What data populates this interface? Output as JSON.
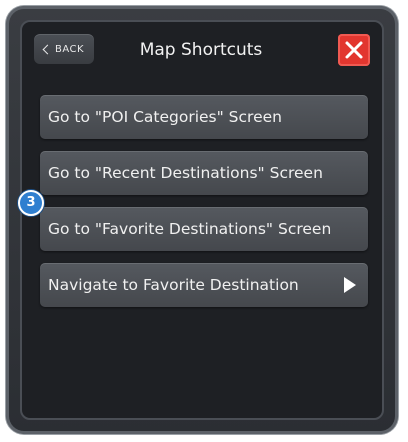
{
  "header": {
    "back_label": "BACK",
    "title": "Map Shortcuts"
  },
  "menu": {
    "items": [
      {
        "label": "Go to \"POI Categories\" Screen"
      },
      {
        "label": "Go to \"Recent Destinations\" Screen"
      },
      {
        "label": "Go to \"Favorite Destinations\" Screen"
      },
      {
        "label": "Navigate to Favorite Destination"
      }
    ]
  },
  "callout": {
    "number": "3"
  },
  "colors": {
    "close_button": "#e2362f",
    "callout": "#2f7fd0",
    "background": "#1e2024",
    "button": "#4c4f55"
  },
  "icons": {
    "back": "chevron-left-icon",
    "close": "close-icon",
    "submenu": "play-arrow-icon"
  }
}
